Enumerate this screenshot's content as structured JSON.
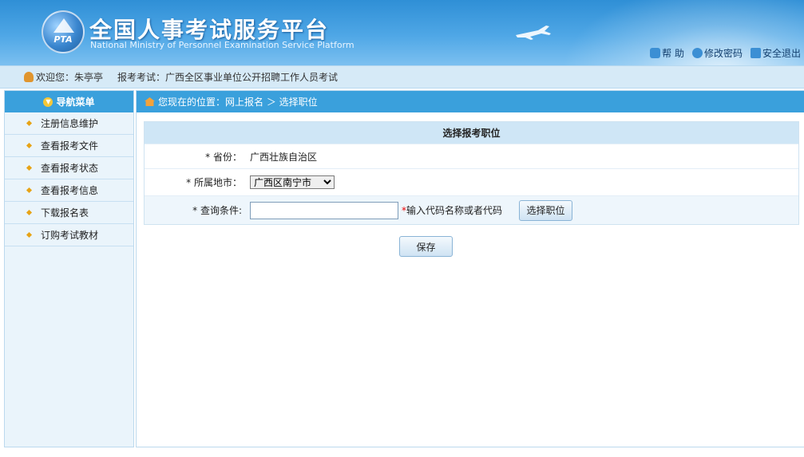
{
  "header": {
    "logo_text": "PTA",
    "title": "全国人事考试服务平台",
    "subtitle": "National Ministry of Personnel Examination Service Platform",
    "links": [
      {
        "icon": "help-icon",
        "label": "帮 助",
        "color": "#3b8fd4"
      },
      {
        "icon": "question-icon",
        "label": "修改密码",
        "color": "#3b8fd4"
      },
      {
        "icon": "logout-icon",
        "label": "安全退出",
        "color": "#3b8fd4"
      }
    ]
  },
  "welcome": {
    "greeting": "欢迎您：朱亭亭",
    "exam": "报考考试：广西全区事业单位公开招聘工作人员考试"
  },
  "sidebar": {
    "header": "导航菜单",
    "items": [
      {
        "label": "注册信息维护"
      },
      {
        "label": "查看报考文件"
      },
      {
        "label": "查看报考状态"
      },
      {
        "label": "查看报考信息"
      },
      {
        "label": "下载报名表"
      },
      {
        "label": "订购考试教材"
      }
    ]
  },
  "breadcrumb": {
    "text": "您现在的位置：网上报名 ＞ 选择职位"
  },
  "form": {
    "title": "选择报考职位",
    "province_label": "* 省份：",
    "province_value": "广西壮族自治区",
    "city_label": "* 所属地市：",
    "city_selected": "广西区南宁市",
    "query_label": "* 查询条件:",
    "query_value": "",
    "query_hint_star": "*",
    "query_hint": "输入代码名称或者代码",
    "select_button": "选择职位",
    "save_button": "保存"
  },
  "colors": {
    "header_blue": "#3aa0dc",
    "panel_title_bg": "#cfe6f6",
    "sidebar_bg": "#eaf4fb"
  }
}
